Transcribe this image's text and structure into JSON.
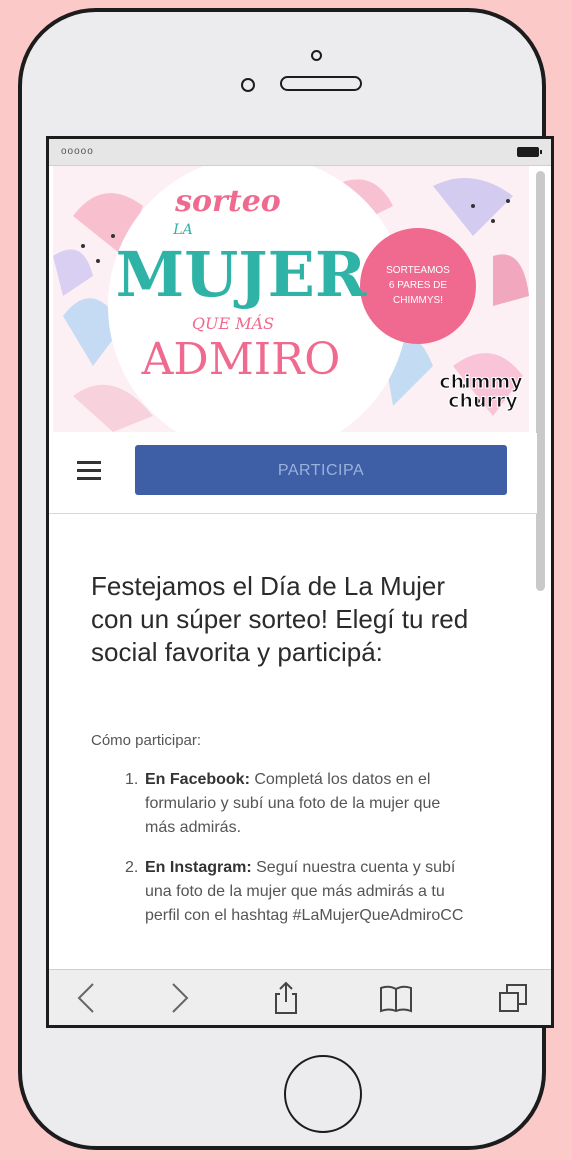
{
  "status": {
    "signal": "ooooo"
  },
  "banner": {
    "sorteo": "sorteo",
    "la": "LA",
    "mujer": "MUJER",
    "que_mas": "QUE MÁS",
    "admiro": "ADMIRO",
    "badge": [
      "SORTEAMOS",
      "6 PARES DE",
      "CHIMMYS!"
    ],
    "brand": [
      "chimmy",
      "churry"
    ]
  },
  "nav": {
    "menu_icon": "hamburger-icon",
    "button_label": "PARTICIPA"
  },
  "content": {
    "headline": "Festejamos el Día de La Mujer con un súper sorteo! Elegí tu red social favorita y participá:",
    "how_to": "Cómo participar:",
    "steps": [
      {
        "num": "1.",
        "title": "En Facebook:",
        "text": " Completá los datos en el formulario y subí una foto de la mujer que más admirás."
      },
      {
        "num": "2.",
        "title": "En Instagram:",
        "text": " Seguí nuestra cuenta y subí una foto de la mujer que más admirás a tu perfil con el hashtag #LaMujerQueAdmiroCC"
      }
    ]
  },
  "toolbar": {
    "icons": [
      "back-arrow-icon",
      "forward-arrow-icon",
      "share-icon",
      "bookmarks-icon",
      "tabs-icon"
    ]
  },
  "colors": {
    "background": "#fcc9c9",
    "button": "#3e5fa6",
    "teal": "#2fb3a6",
    "pink": "#f06a8f"
  }
}
